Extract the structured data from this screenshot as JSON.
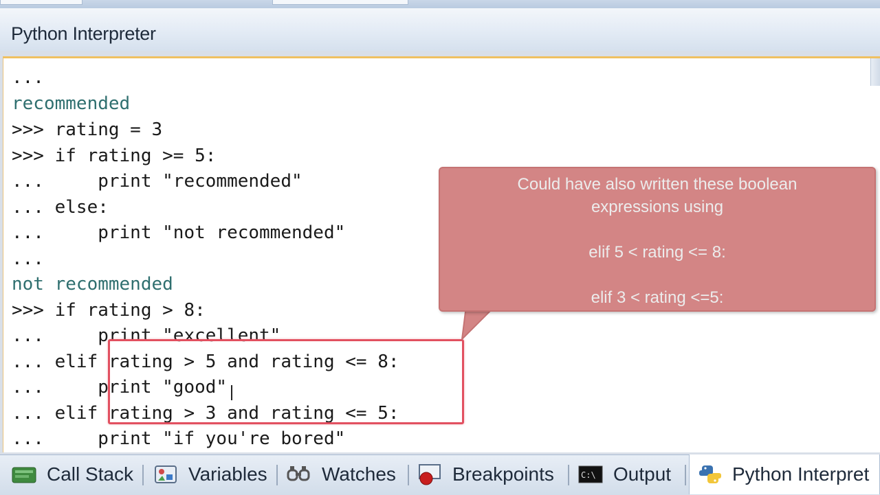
{
  "panel": {
    "title": "Python Interpreter"
  },
  "console": {
    "lines": [
      {
        "text": "...",
        "kind": "prompt"
      },
      {
        "text": "recommended",
        "kind": "output"
      },
      {
        "text": ">>> rating = 3",
        "kind": "input"
      },
      {
        "text": ">>> if rating >= 5:",
        "kind": "input"
      },
      {
        "text": "...     print \"recommended\"",
        "kind": "input"
      },
      {
        "text": "... else:",
        "kind": "input"
      },
      {
        "text": "...     print \"not recommended\"",
        "kind": "input"
      },
      {
        "text": "...",
        "kind": "prompt"
      },
      {
        "text": "not recommended",
        "kind": "output"
      },
      {
        "text": ">>> if rating > 8:",
        "kind": "input"
      },
      {
        "text": "...     print \"excellent\"",
        "kind": "input"
      },
      {
        "text": "... elif rating > 5 and rating <= 8:",
        "kind": "input"
      },
      {
        "text": "...     print \"good\"",
        "kind": "input"
      },
      {
        "text": "... elif rating > 3 and rating <= 5:",
        "kind": "input"
      },
      {
        "text": "...     print \"if you're bored\"",
        "kind": "input"
      }
    ]
  },
  "callout": {
    "line1": "Could have also written these boolean",
    "line2": "expressions using",
    "line3": "elif 5 < rating <= 8:",
    "line4": "elif 3 < rating <=5:"
  },
  "tabs": {
    "call_stack": "Call Stack",
    "variables": "Variables",
    "watches": "Watches",
    "breakpoints": "Breakpoints",
    "output": "Output",
    "python_interpreter": "Python Interpret"
  },
  "colors": {
    "output_text": "#2f6f6f",
    "highlight_border": "#e25060",
    "callout_bg": "#d38585"
  }
}
